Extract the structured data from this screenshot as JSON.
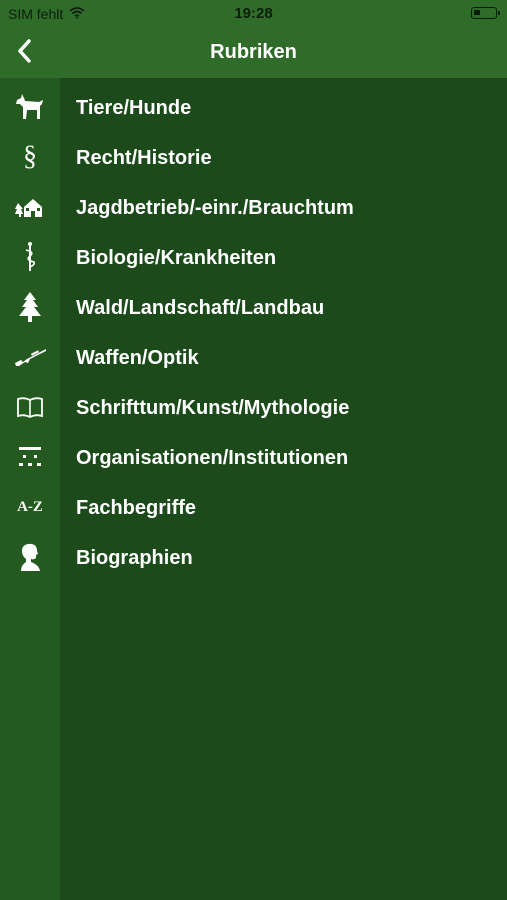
{
  "status_bar": {
    "carrier": "SIM fehlt",
    "time": "19:28",
    "wifi_icon": "wifi-icon",
    "battery_icon": "battery-icon"
  },
  "nav": {
    "title": "Rubriken",
    "back_icon": "chevron-left-icon"
  },
  "colors": {
    "bar": "#2f6c2a",
    "icon_column": "#245a20",
    "background": "#1c4a1a",
    "text": "#ffffff"
  },
  "categories": [
    {
      "label": "Tiere/Hunde",
      "icon": "dog-icon"
    },
    {
      "label": "Recht/Historie",
      "icon": "paragraph-icon",
      "glyph": "§"
    },
    {
      "label": "Jagdbetrieb/-einr./Brauchtum",
      "icon": "lodge-icon"
    },
    {
      "label": "Biologie/Krankheiten",
      "icon": "caduceus-icon"
    },
    {
      "label": "Wald/Landschaft/Landbau",
      "icon": "tree-icon"
    },
    {
      "label": "Waffen/Optik",
      "icon": "rifle-icon"
    },
    {
      "label": "Schrifttum/Kunst/Mythologie",
      "icon": "book-icon"
    },
    {
      "label": "Organisationen/Institutionen",
      "icon": "organization-icon"
    },
    {
      "label": "Fachbegriffe",
      "icon": "a-z-icon",
      "glyph": "A-Z"
    },
    {
      "label": "Biographien",
      "icon": "person-profile-icon"
    }
  ]
}
